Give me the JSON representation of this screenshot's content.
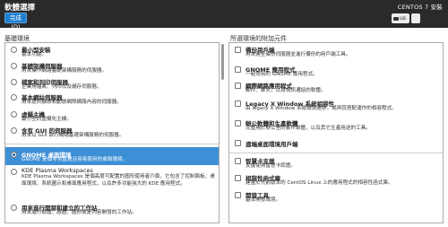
{
  "header": {
    "title": "軟體選擇",
    "done_label": "完成(D)",
    "product": "CENTOS 7 安裝",
    "keyboard": "us"
  },
  "left": {
    "heading": "基礎環境",
    "items": [
      {
        "name": "最小型安裝",
        "desc": "基本功能。"
      },
      {
        "name": "基礎架構伺服器",
        "desc": "用來操作網路基礎架構服務的伺服器。"
      },
      {
        "name": "檔案和列印伺服器",
        "desc": "企業用檔案、列印以及儲存伺服器。"
      },
      {
        "name": "基本網站伺服器",
        "desc": "用來提供靜態和動態網際網路內容的伺服器。"
      },
      {
        "name": "虛擬主機",
        "desc": "最小型的虛擬化主機。"
      },
      {
        "name": "含有 GUI 的伺服器",
        "desc": "用來以 GUI 執行網路基礎架構服務的伺服器。"
      },
      {
        "name": "GNOME 桌面環境",
        "desc": "GNOME 是個非常直覺且容易使用的桌面環境。"
      },
      {
        "name": "KDE Plasma Workspaces",
        "desc": "KDE Plasma Workspaces 是個高度可配置的圖形使用者介面，它包含了控制面板、桌面環境、系統圖示和桌面應用程式，以及許多功能強大的 KDE 應用程式。"
      },
      {
        "name": "用來進行開發和建立的工作站",
        "desc": "用來進行軟體、應體、圖形或是內容開發的工作站。"
      }
    ]
  },
  "right": {
    "heading": "所選環境的附加元件",
    "items": [
      {
        "name": "備份用戶端",
        "desc": "用來連至備份伺服器並進行備份的用戶端工具。"
      },
      {
        "name": "GNOME 應用程式",
        "desc": "一組常用的 GNOME 應用程式。"
      },
      {
        "name": "網際網路應用程式",
        "desc": "郵件、聊天，以及視訊通話的軟體。"
      },
      {
        "name": "Legacy X Window 系統相容性",
        "desc": "由 legacy X Window 系統環境遷移，或與其搭配運作的相容程式。"
      },
      {
        "name": "辦公軟體和生產軟體",
        "desc": "完整用於辦公室的套件軟體，以及其它生產用途的工具。"
      },
      {
        "name": "遠端桌面環境用戶端",
        "desc": ""
      },
      {
        "name": "智慧卡支援",
        "desc": "支援使用智慧卡認證。"
      },
      {
        "name": "相容性函式庫",
        "desc": "建置於先前版本的 CentOS Linux 上的應用程式的相容性函式庫。"
      },
      {
        "name": "開發工具",
        "desc": "基本開發環境。"
      }
    ]
  }
}
